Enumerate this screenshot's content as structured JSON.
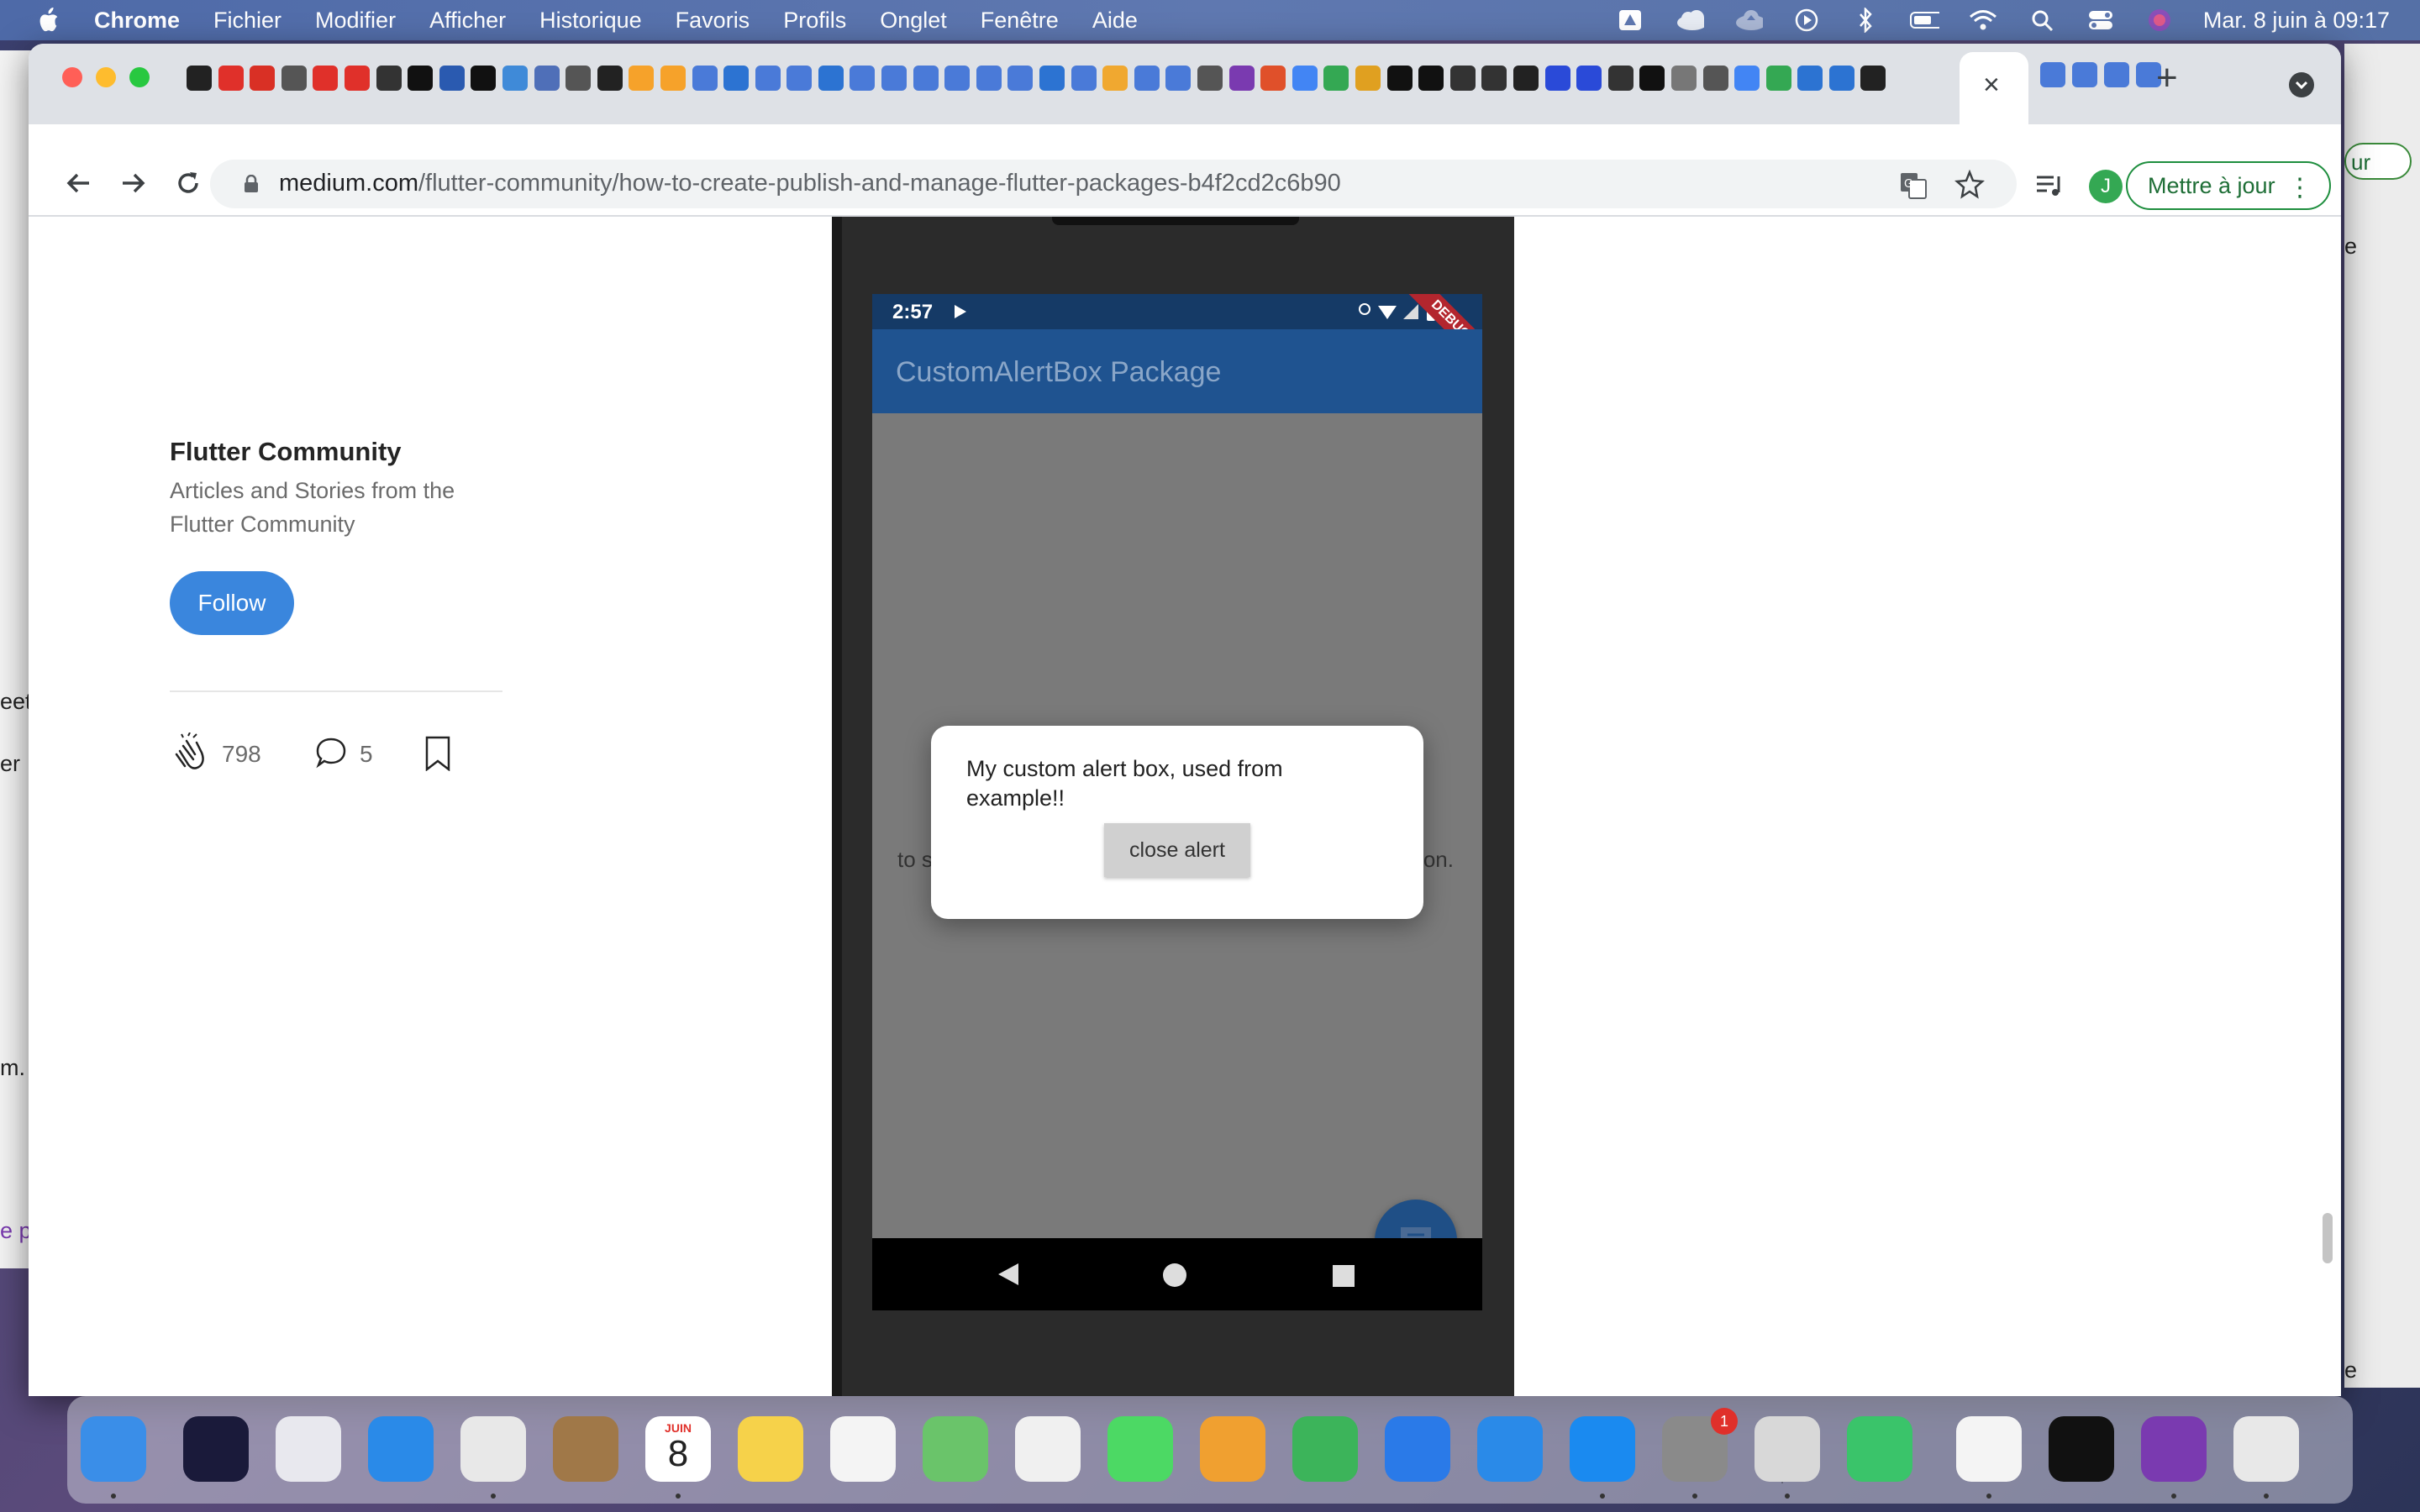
{
  "menubar": {
    "app_name": "Chrome",
    "menus": [
      "Fichier",
      "Modifier",
      "Afficher",
      "Historique",
      "Favoris",
      "Profils",
      "Onglet",
      "Fenêtre",
      "Aide"
    ],
    "clock": "Mar. 8 juin à  09:17"
  },
  "browser": {
    "url_host": "medium.com",
    "url_path": "/flutter-community/how-to-create-publish-and-manage-flutter-packages-b4f2cd2c6b90",
    "profile_initial": "J",
    "update_label": "Mettre à jour",
    "close_tab_symbol": "×",
    "new_tab_symbol": "+",
    "menu_symbol": "⋮"
  },
  "article": {
    "publication_name": "Flutter Community",
    "publication_description": "Articles and Stories from the Flutter Community",
    "follow_label": "Follow",
    "claps": "798",
    "comments": "5"
  },
  "phone": {
    "status_time": "2:57",
    "debug_label": "DEBUG",
    "appbar_title": "CustomAlertBox Package",
    "behind_text_left": "to s",
    "behind_text_right": "on.",
    "dialog_message": "My custom alert box, used from example!!",
    "dialog_button": "close alert"
  },
  "side_peek": {
    "lines": [
      "eet",
      "er",
      "m.",
      "e p"
    ],
    "right_btn": "ur",
    "right_lines": [
      "e",
      "e"
    ]
  },
  "dock": {
    "calendar_month": "JUIN",
    "calendar_day": "8",
    "sysprefs_badge": "1"
  },
  "colors": {
    "follow_button": "#3a86dd",
    "app_bar": "#1f5390",
    "status_bar": "#153a66",
    "update_button_border": "#1e8e3e"
  }
}
